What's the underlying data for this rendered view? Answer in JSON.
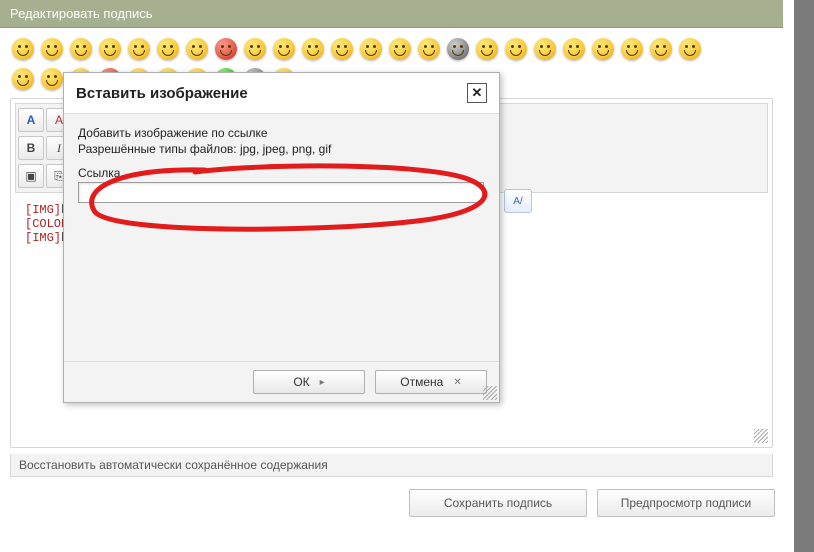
{
  "panel": {
    "title": "Редактировать подпись"
  },
  "emoji_rows": [
    [
      "smile",
      "grin",
      "wink",
      "cool",
      "laugh",
      "mask",
      "glasses",
      "angry",
      "oops",
      "blush",
      "surprised",
      "yawn",
      "confused",
      "cry",
      "dead",
      "gray-confused",
      "kiss",
      "sleep",
      "eyebrow",
      "crazy",
      "sun",
      "dizzy",
      "hearts",
      "sly"
    ],
    [
      "tongue",
      "sad",
      "party",
      "devil",
      "angel",
      "music",
      "heart",
      "green-sick",
      "bomb",
      "boom"
    ]
  ],
  "toolbar": {
    "row1": [
      {
        "name": "font-color-a",
        "label": "A",
        "cls": "blue"
      },
      {
        "name": "font-color-b",
        "label": "A",
        "cls": "red"
      },
      {
        "name": "remove-format-icon",
        "label": "⌫",
        "cls": ""
      }
    ],
    "row2": [
      {
        "name": "bold-button",
        "label": "B",
        "style": "font-weight:bold"
      },
      {
        "name": "italic-button",
        "label": "I",
        "style": "font-style:italic;font-family:serif"
      }
    ],
    "row3": [
      {
        "name": "insert-image-button",
        "label": "▣",
        "cls": ""
      },
      {
        "name": "insert-link-button",
        "label": "⎘",
        "cls": ""
      }
    ]
  },
  "float_btn_label": "A/",
  "editor_lines": [
    "[IMG]ht",
    "[COLOR",
    "[IMG]ht"
  ],
  "restore_label": "Восстановить автоматически сохранённое содержания",
  "bottom_buttons": {
    "save": "Сохранить подпись",
    "preview": "Предпросмотр подписи"
  },
  "modal": {
    "title": "Вставить изображение",
    "desc1": "Добавить изображение по ссылке",
    "desc2": "Разрешённые типы файлов: jpg, jpeg, png, gif",
    "field_label": "Ссылка",
    "url_value": "",
    "ok": "ОК",
    "cancel": "Отмена"
  }
}
